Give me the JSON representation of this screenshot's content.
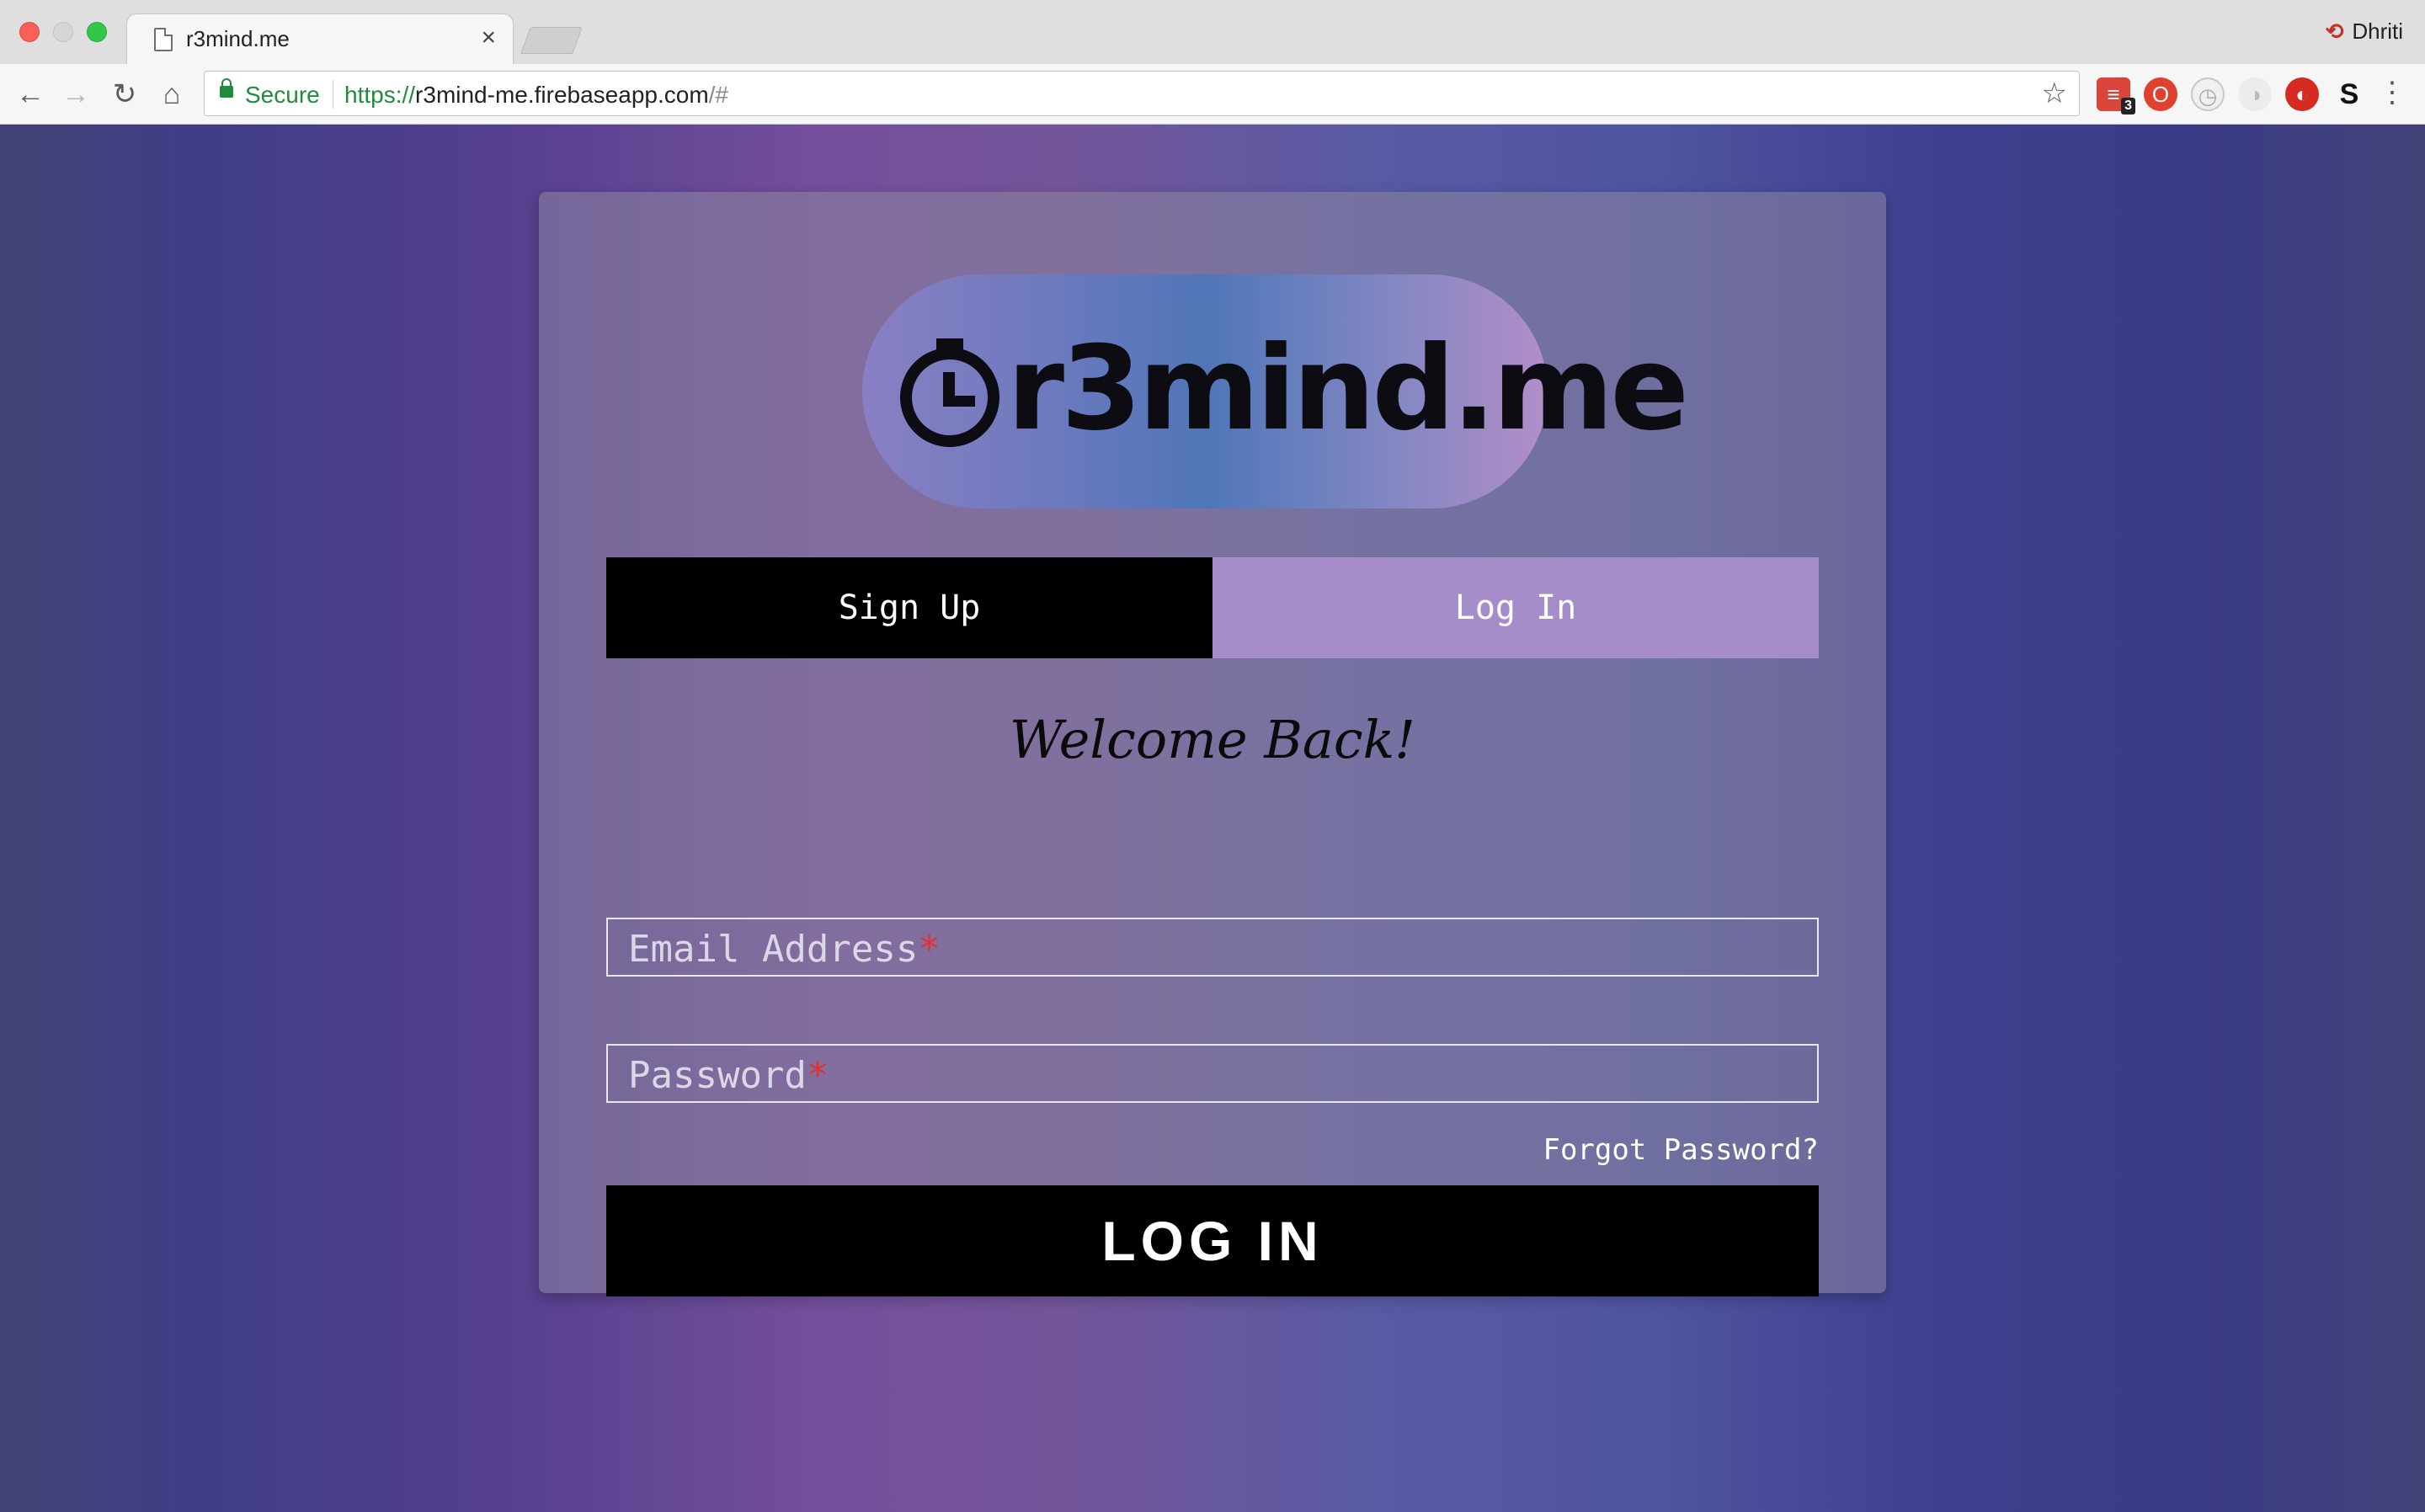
{
  "browser": {
    "tab_title": "r3mind.me",
    "tab_close": "×",
    "profile_name": "Dhriti",
    "security_label": "Secure",
    "url_scheme": "https://",
    "url_host": "r3mind-me.firebaseapp.com",
    "url_rest": "/#",
    "extension_badge": "3"
  },
  "app": {
    "logo_text": "r3mind.me",
    "tabs": [
      {
        "label": "Sign Up",
        "active": false
      },
      {
        "label": "Log In",
        "active": true
      }
    ],
    "welcome": "Welcome Back!",
    "email_placeholder": "Email Address",
    "password_placeholder": "Password",
    "required_mark": "*",
    "forgot_password": "Forgot Password?",
    "submit_label": "LOG IN"
  },
  "colors": {
    "tab_inactive_bg": "#000000",
    "tab_active_bg": "#a58dc9",
    "required": "#e0342e"
  },
  "icons": [
    "page-icon",
    "back-icon",
    "forward-icon",
    "reload-icon",
    "home-icon",
    "lock-icon",
    "star-icon",
    "menu-icon",
    "clock-icon"
  ]
}
